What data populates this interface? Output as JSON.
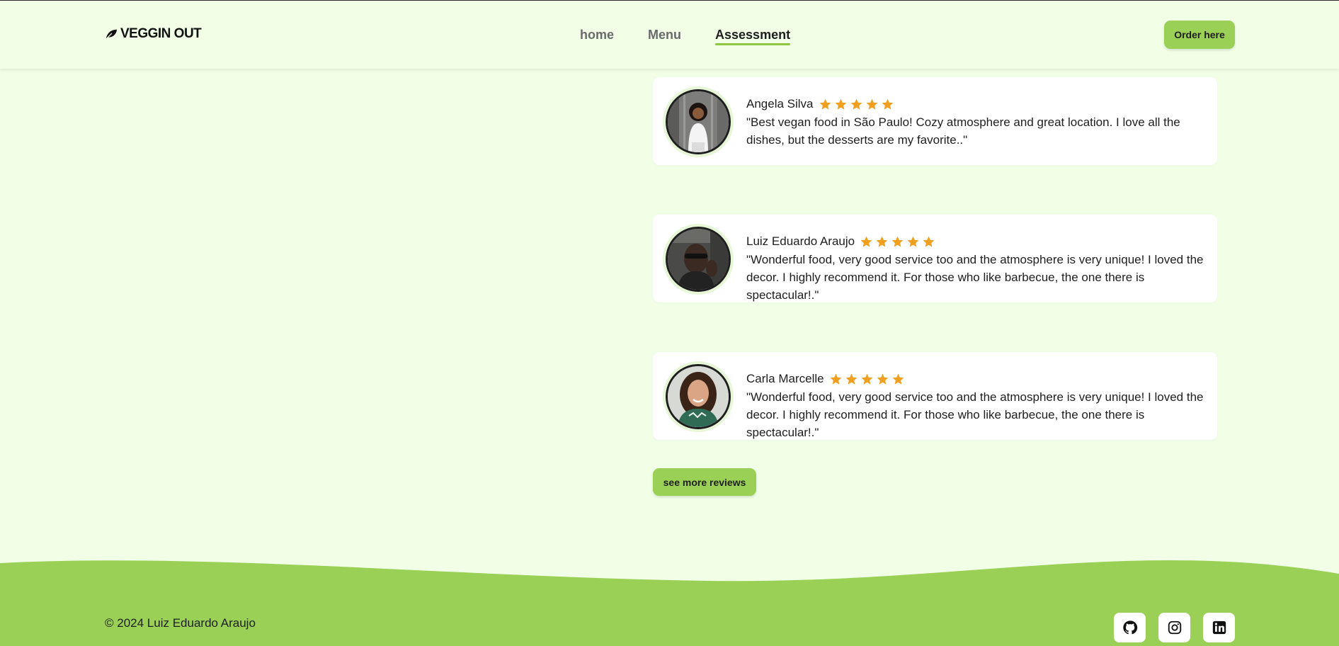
{
  "brand": {
    "name": "VEGGIN OUT"
  },
  "nav": {
    "items": [
      {
        "label": "home"
      },
      {
        "label": "Menu"
      },
      {
        "label": "Assessment"
      }
    ]
  },
  "header": {
    "order_label": "Order here"
  },
  "reviews": [
    {
      "name": "Angela Silva",
      "rating": 5,
      "text": "\"Best vegan food in São Paulo! Cozy atmosphere and great location. I love all the dishes, but the desserts are my favorite..\""
    },
    {
      "name": "Luiz Eduardo Araujo",
      "rating": 5,
      "text": "\"Wonderful food, very good service too and the atmosphere is very unique! I loved the decor. I highly recommend it. For those who like barbecue, the one there is spectacular!.\""
    },
    {
      "name": "Carla Marcelle",
      "rating": 5,
      "text": "\"Wonderful food, very good service too and the atmosphere is very unique! I loved the decor. I highly recommend it. For those who like barbecue, the one there is spectacular!.\""
    }
  ],
  "more_reviews_label": "see more reviews",
  "footer": {
    "copyright": "© 2024 Luiz Eduardo Araujo",
    "social": [
      {
        "icon": "github-icon"
      },
      {
        "icon": "instagram-icon"
      },
      {
        "icon": "linkedin-icon"
      }
    ]
  },
  "colors": {
    "background": "#f0ffe6",
    "accent": "#9ad055",
    "star": "#f0a020",
    "text": "#1e1e1e"
  }
}
